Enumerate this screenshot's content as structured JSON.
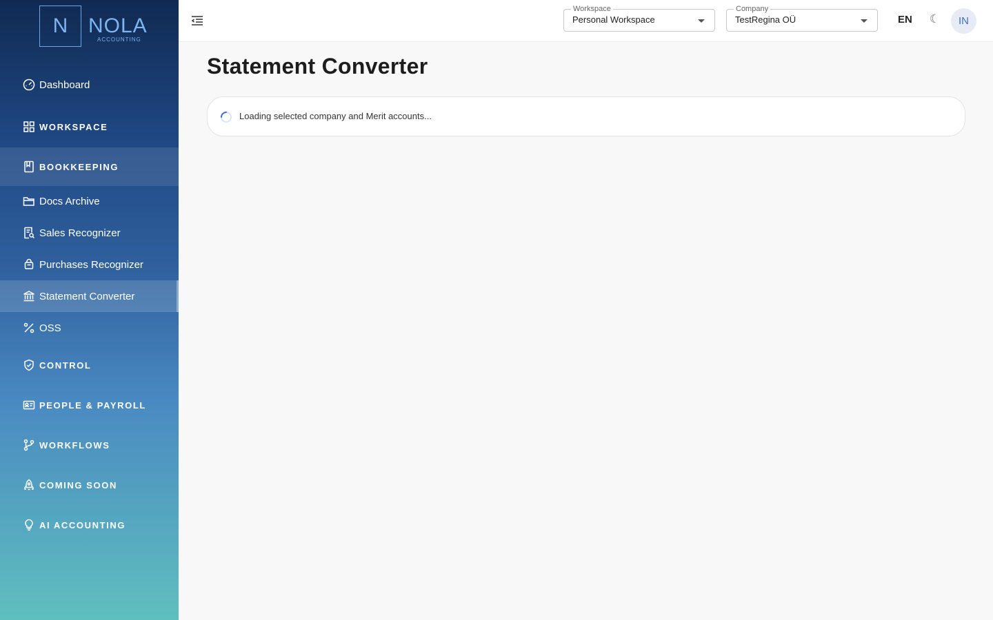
{
  "logo": {
    "letter": "N",
    "word": "NOLA",
    "sub": "ACCOUNTING"
  },
  "sidebar": {
    "items": [
      {
        "label": "Dashboard",
        "icon": "gauge-icon"
      },
      {
        "label": "WORKSPACE",
        "icon": "grid-icon"
      },
      {
        "label": "BOOKKEEPING",
        "icon": "book-icon"
      },
      {
        "label": "Docs Archive",
        "icon": "folder-icon"
      },
      {
        "label": "Sales Recognizer",
        "icon": "receipt-search-icon"
      },
      {
        "label": "Purchases Recognizer",
        "icon": "bag-icon"
      },
      {
        "label": "Statement Converter",
        "icon": "bank-icon"
      },
      {
        "label": "OSS",
        "icon": "percent-icon"
      },
      {
        "label": "CONTROL",
        "icon": "shield-check-icon"
      },
      {
        "label": "PEOPLE & PAYROLL",
        "icon": "id-card-icon"
      },
      {
        "label": "WORKFLOWS",
        "icon": "branch-icon"
      },
      {
        "label": "COMING SOON",
        "icon": "rocket-icon"
      },
      {
        "label": "AI ACCOUNTING",
        "icon": "bulb-icon"
      }
    ]
  },
  "header": {
    "workspace": {
      "label": "Workspace",
      "value": "Personal Workspace"
    },
    "company": {
      "label": "Company",
      "value": "TestRegina OÜ"
    },
    "language": "EN",
    "theme_icon": "☾",
    "avatar_initials": "IN"
  },
  "main": {
    "title": "Statement Converter",
    "loading_text": "Loading selected company and Merit accounts..."
  },
  "colors": {
    "accent": "#3f6fc7",
    "sidebar_top": "#102a52",
    "sidebar_bottom": "#5fbfbe"
  }
}
